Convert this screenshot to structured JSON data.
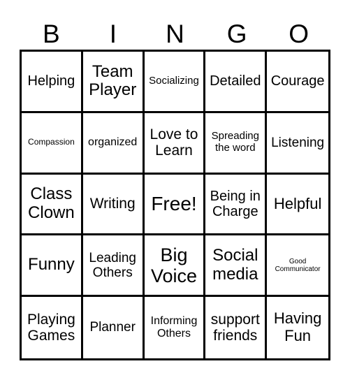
{
  "header": [
    "B",
    "I",
    "N",
    "G",
    "O"
  ],
  "cells": [
    [
      "Helping",
      "Team Player",
      "Socializing",
      "Detailed",
      "Courage"
    ],
    [
      "Compassion",
      "organized",
      "Love to Learn",
      "Spreading the word",
      "Listening"
    ],
    [
      "Class Clown",
      "Writing",
      "Free!",
      "Being in Charge",
      "Helpful"
    ],
    [
      "Funny",
      "Leading Others",
      "Big Voice",
      "Social media",
      "Good Communicator"
    ],
    [
      "Playing Games",
      "Planner",
      "Informing Others",
      "support friends",
      "Having Fun"
    ]
  ]
}
